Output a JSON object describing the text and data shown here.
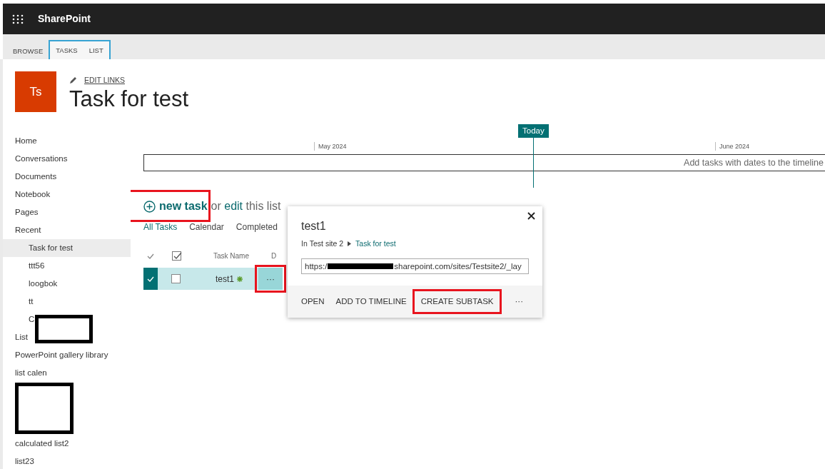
{
  "app": {
    "title": "SharePoint"
  },
  "ribbon_tabs": [
    {
      "label": "BROWSE",
      "contextual": false
    },
    {
      "label": "TASKS",
      "contextual": true
    },
    {
      "label": "LIST",
      "contextual": true
    }
  ],
  "site": {
    "logo_text": "Ts",
    "edit_links": "EDIT LINKS",
    "title": "Task for test"
  },
  "nav": [
    {
      "label": "Home",
      "selected": false
    },
    {
      "label": "Conversations",
      "selected": false
    },
    {
      "label": "Documents",
      "selected": false
    },
    {
      "label": "Notebook",
      "selected": false
    },
    {
      "label": "Pages",
      "selected": false
    },
    {
      "label": "Recent",
      "selected": false,
      "children": [
        {
          "label": "Task for test",
          "selected": true
        },
        {
          "label": "ttt56",
          "selected": false
        },
        {
          "label": "loogbok",
          "selected": false
        },
        {
          "label": "tt",
          "selected": false
        },
        {
          "label": "C",
          "selected": false
        }
      ]
    },
    {
      "label": "List",
      "selected": false
    },
    {
      "label": "PowerPoint gallery library",
      "selected": false
    },
    {
      "label": "list calen",
      "selected": false
    },
    {
      "label": "calculated list2",
      "selected": false
    },
    {
      "label": "list23",
      "selected": false
    }
  ],
  "timeline": {
    "today_label": "Today",
    "months": [
      "May 2024",
      "June 2024"
    ],
    "empty_text": "Add tasks with dates to the timeline"
  },
  "list": {
    "new_task": "new task",
    "edit_prompt": {
      "before": "or",
      "link": "edit",
      "after": "this list"
    },
    "views": [
      {
        "label": "All Tasks",
        "selected": true
      },
      {
        "label": "Calendar",
        "selected": false
      },
      {
        "label": "Completed",
        "selected": false
      }
    ],
    "columns": [
      "Task Name",
      "D"
    ],
    "rows": [
      {
        "selected": true,
        "checked": false,
        "task_name": "test1",
        "is_new": true,
        "menu": "···"
      }
    ]
  },
  "callout": {
    "title": "test1",
    "location_prefix": "In",
    "site": "Test site 2",
    "list": "Task for test",
    "url_start": "https:/",
    "url_end": "sharepoint.com/sites/Testsite2/_lay",
    "actions": [
      "OPEN",
      "ADD TO TIMELINE",
      "CREATE SUBTASK",
      "···"
    ]
  }
}
